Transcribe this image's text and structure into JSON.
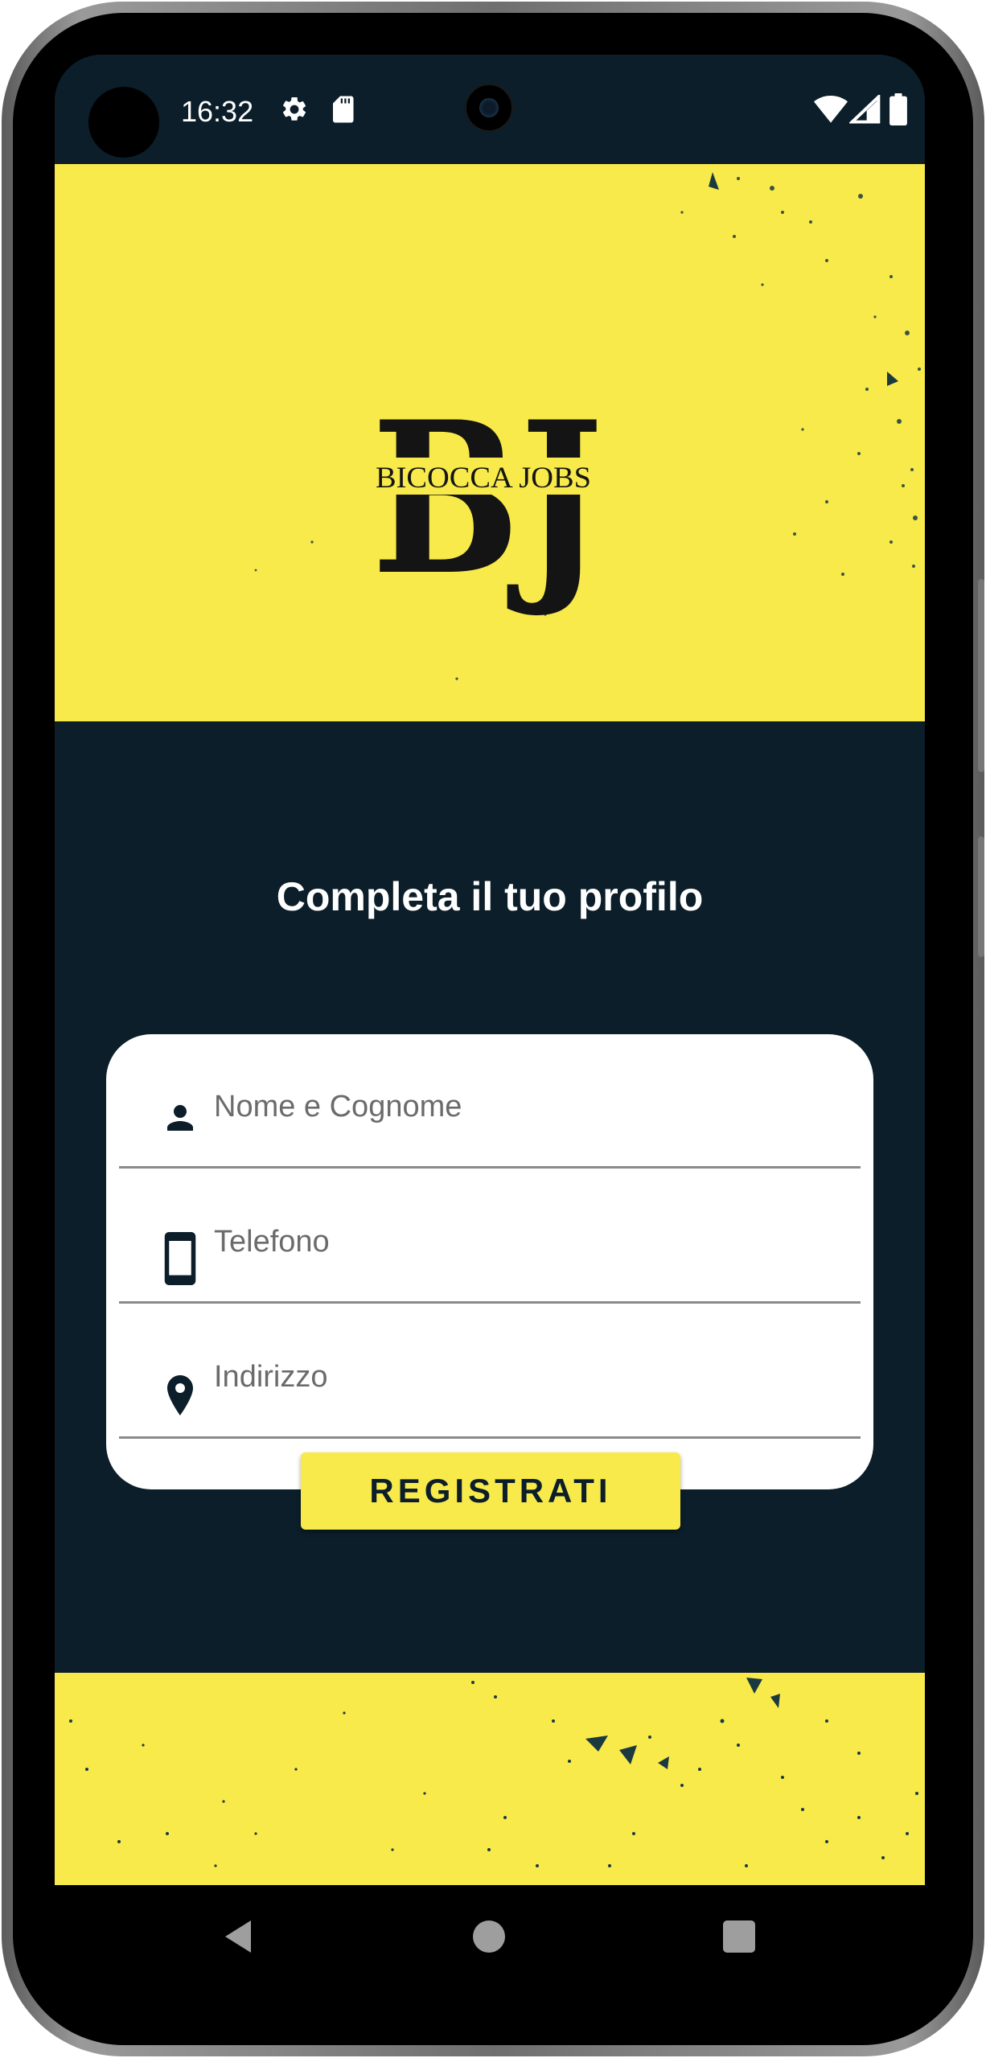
{
  "status_bar": {
    "time": "16:32"
  },
  "logo": {
    "text": "BICOCCA JOBS",
    "monogram": "BJ"
  },
  "page": {
    "title": "Completa il tuo profilo"
  },
  "form": {
    "fields": [
      {
        "placeholder": "Nome e Cognome",
        "value": "",
        "icon": "person-icon"
      },
      {
        "placeholder": "Telefono",
        "value": "",
        "icon": "smartphone-icon"
      },
      {
        "placeholder": "Indirizzo",
        "value": "",
        "icon": "location-pin-icon"
      }
    ],
    "submit_label": "REGISTRATI"
  },
  "colors": {
    "accent_yellow": "#f8ea4a",
    "background_navy": "#0b1e29",
    "card_white": "#ffffff"
  },
  "icons": {
    "status": [
      "gear-icon",
      "sd-card-icon",
      "wifi-icon",
      "signal-icon",
      "battery-icon"
    ],
    "navigation": [
      "back-icon",
      "home-icon",
      "recents-icon"
    ]
  }
}
